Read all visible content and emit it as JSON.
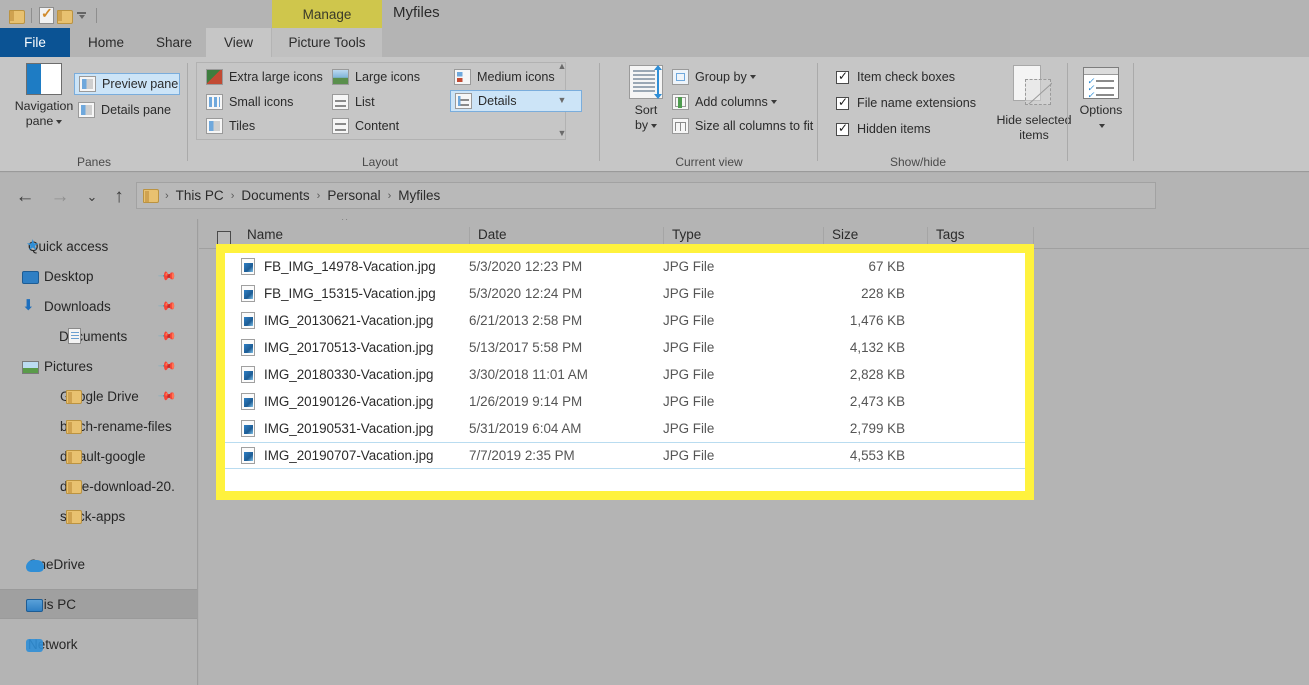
{
  "window": {
    "title": "Myfiles",
    "contextual_tab_group": "Manage",
    "quick_access": [
      {
        "name": "folder-icon",
        "label": "Folder"
      },
      {
        "name": "properties-icon",
        "label": "Properties"
      },
      {
        "name": "new-folder-icon",
        "label": "New folder"
      },
      {
        "name": "customize-qat-icon",
        "label": "Customize Quick Access Toolbar"
      }
    ]
  },
  "tabs": [
    {
      "id": "file",
      "label": "File"
    },
    {
      "id": "home",
      "label": "Home"
    },
    {
      "id": "share",
      "label": "Share"
    },
    {
      "id": "view",
      "label": "View"
    },
    {
      "id": "picture-tools",
      "label": "Picture Tools"
    }
  ],
  "ribbon": {
    "groups": [
      {
        "id": "panes",
        "label": "Panes",
        "big_button": {
          "label_line1": "Navigation",
          "label_line2": "pane"
        },
        "commands": [
          {
            "label": "Preview pane",
            "selected": true
          },
          {
            "label": "Details pane",
            "selected": false
          }
        ]
      },
      {
        "id": "layout",
        "label": "Layout",
        "commands": [
          {
            "label": "Extra large icons",
            "selected": false
          },
          {
            "label": "Large icons",
            "selected": false
          },
          {
            "label": "Medium icons",
            "selected": false
          },
          {
            "label": "Small icons",
            "selected": false
          },
          {
            "label": "List",
            "selected": false
          },
          {
            "label": "Details",
            "selected": true
          },
          {
            "label": "Tiles",
            "selected": false
          },
          {
            "label": "Content",
            "selected": false
          }
        ]
      },
      {
        "id": "current-view",
        "label": "Current view",
        "big_button": {
          "label_line1": "Sort",
          "label_line2": "by"
        },
        "commands": [
          {
            "label": "Group by",
            "has_menu": true
          },
          {
            "label": "Add columns",
            "has_menu": true
          },
          {
            "label": "Size all columns to fit",
            "has_menu": false
          }
        ]
      },
      {
        "id": "show-hide",
        "label": "Show/hide",
        "checkboxes": [
          {
            "label": "Item check boxes",
            "checked": true
          },
          {
            "label": "File name extensions",
            "checked": true
          },
          {
            "label": "Hidden items",
            "checked": true
          }
        ],
        "big_buttons": [
          {
            "label_line1": "Hide selected",
            "label_line2": "items"
          }
        ]
      },
      {
        "id": "options",
        "label": "",
        "big_button": {
          "label_line1": "Options",
          "label_line2": ""
        }
      }
    ]
  },
  "addressbar": {
    "back_icon": "back-arrow-icon",
    "forward_icon": "forward-arrow-icon",
    "recent_icon": "recent-locations-icon",
    "up_icon": "up-arrow-icon",
    "breadcrumbs": [
      "This PC",
      "Documents",
      "Personal",
      "Myfiles"
    ],
    "separator": "›"
  },
  "sidebar": {
    "items": [
      {
        "label": "Quick access",
        "icon": "star-icon",
        "level": "root",
        "pinned": false,
        "selected": false
      },
      {
        "label": "Desktop",
        "icon": "desktop-icon",
        "level": "child",
        "pinned": true,
        "selected": false
      },
      {
        "label": "Downloads",
        "icon": "download-icon",
        "level": "child",
        "pinned": true,
        "selected": false
      },
      {
        "label": "Documents",
        "icon": "document-icon",
        "level": "child",
        "pinned": true,
        "selected": false
      },
      {
        "label": "Pictures",
        "icon": "pictures-icon",
        "level": "child",
        "pinned": true,
        "selected": false
      },
      {
        "label": "Google Drive",
        "icon": "folder-icon",
        "level": "child",
        "pinned": true,
        "selected": false
      },
      {
        "label": "batch-rename-files",
        "icon": "folder-icon",
        "level": "child",
        "pinned": false,
        "selected": false
      },
      {
        "label": "default-google",
        "icon": "folder-icon",
        "level": "child",
        "pinned": false,
        "selected": false
      },
      {
        "label": "drive-download-20.",
        "icon": "folder-icon",
        "level": "child",
        "pinned": false,
        "selected": false
      },
      {
        "label": "stock-apps",
        "icon": "folder-icon",
        "level": "child",
        "pinned": false,
        "selected": false
      },
      {
        "label": "OneDrive",
        "icon": "onedrive-icon",
        "level": "root",
        "pinned": false,
        "selected": false
      },
      {
        "label": "This PC",
        "icon": "this-pc-icon",
        "level": "root",
        "pinned": false,
        "selected": true
      },
      {
        "label": "Network",
        "icon": "network-icon",
        "level": "root",
        "pinned": false,
        "selected": false
      }
    ]
  },
  "filelist": {
    "columns": [
      {
        "key": "name",
        "label": "Name",
        "sorted": true,
        "sort_dir": "asc"
      },
      {
        "key": "date",
        "label": "Date"
      },
      {
        "key": "type",
        "label": "Type"
      },
      {
        "key": "size",
        "label": "Size"
      },
      {
        "key": "tags",
        "label": "Tags"
      }
    ],
    "rows": [
      {
        "name": "FB_IMG_14978-Vacation.jpg",
        "date": "5/3/2020 12:23 PM",
        "type": "JPG File",
        "size": "67 KB",
        "hover": false
      },
      {
        "name": "FB_IMG_15315-Vacation.jpg",
        "date": "5/3/2020 12:24 PM",
        "type": "JPG File",
        "size": "228 KB",
        "hover": false
      },
      {
        "name": "IMG_20130621-Vacation.jpg",
        "date": "6/21/2013 2:58 PM",
        "type": "JPG File",
        "size": "1,476 KB",
        "hover": false
      },
      {
        "name": "IMG_20170513-Vacation.jpg",
        "date": "5/13/2017 5:58 PM",
        "type": "JPG File",
        "size": "4,132 KB",
        "hover": false
      },
      {
        "name": "IMG_20180330-Vacation.jpg",
        "date": "3/30/2018 11:01 AM",
        "type": "JPG File",
        "size": "2,828 KB",
        "hover": false
      },
      {
        "name": "IMG_20190126-Vacation.jpg",
        "date": "1/26/2019 9:14 PM",
        "type": "JPG File",
        "size": "2,473 KB",
        "hover": false
      },
      {
        "name": "IMG_20190531-Vacation.jpg",
        "date": "5/31/2019 6:04 AM",
        "type": "JPG File",
        "size": "2,799 KB",
        "hover": false
      },
      {
        "name": "IMG_20190707-Vacation.jpg",
        "date": "7/7/2019 2:35 PM",
        "type": "JPG File",
        "size": "4,553 KB",
        "hover": true
      }
    ]
  },
  "colors": {
    "highlight_box": "#fff23d",
    "file_tab": "#0b5394",
    "contextual_tab": "#cfc64c",
    "chrome": "#b4b4b4",
    "ribbon": "#c6c6c6"
  }
}
